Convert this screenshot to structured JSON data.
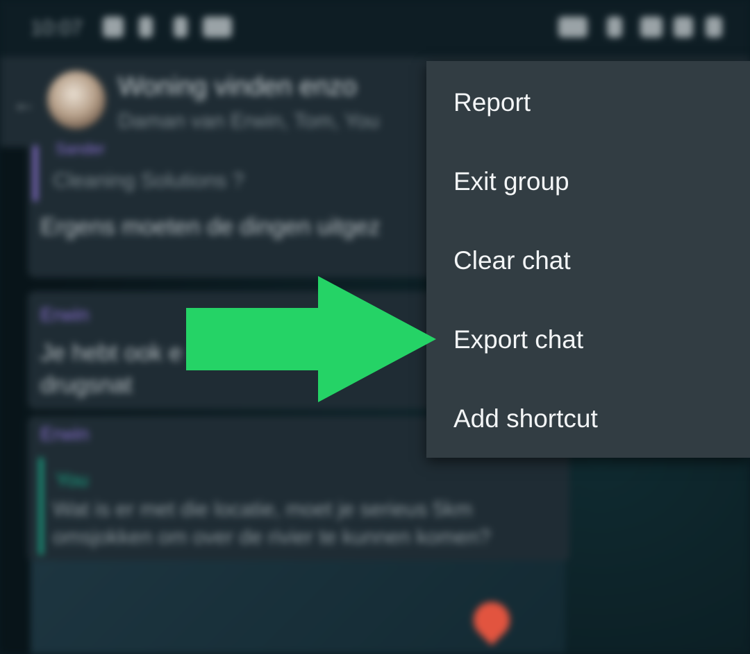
{
  "status_bar": {
    "time": "10:07"
  },
  "chat_header": {
    "group_name": "Woning vinden enzo",
    "participants": "Daman van Erwin, Tom, You",
    "back_icon": "arrow-left-icon"
  },
  "messages": [
    {
      "sender": "Sander",
      "quote": "Cleaning Solutions ?",
      "text": "Ergens moeten de dingen uitgez",
      "accent": "#8a6fd1"
    },
    {
      "sender": "Erwin",
      "text_lines": [
        "Je hebt ook e",
        "drugsnat"
      ],
      "accent": "#8a6fd1"
    },
    {
      "sender": "Erwin",
      "quote_sender": "You",
      "quote_lines": [
        "Wat is er met die locatie, moet je serieus 5km",
        "omsjokken om over de rivier te kunnen komen?"
      ],
      "accent_sender": "#8a6fd1",
      "accent_quote": "#19a584"
    }
  ],
  "menu": {
    "items": [
      {
        "label": "Report"
      },
      {
        "label": "Exit group"
      },
      {
        "label": "Clear chat"
      },
      {
        "label": "Export chat"
      },
      {
        "label": "Add shortcut"
      }
    ]
  },
  "annotation": {
    "icon": "arrow-right-icon",
    "color": "#25d366",
    "points_to": "Export chat"
  }
}
